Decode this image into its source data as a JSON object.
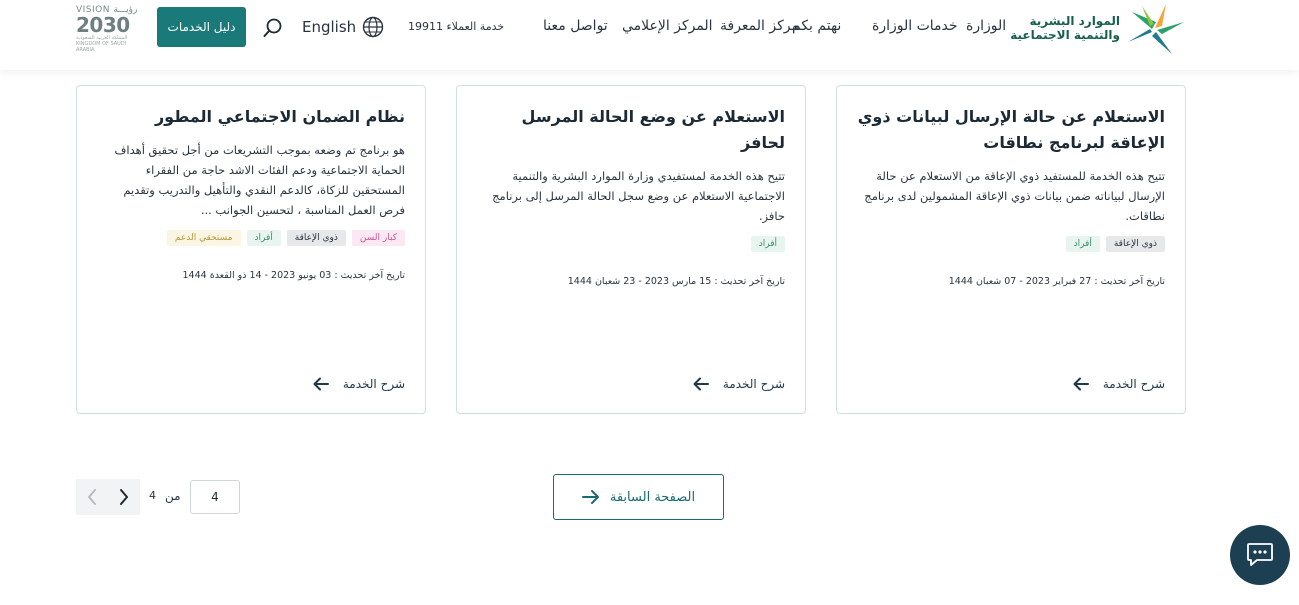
{
  "header": {
    "logo_text_line1": "الموارد البشرية",
    "logo_text_line2": "والتنمية الاجتماعية",
    "nav": [
      {
        "label": "الوزارة"
      },
      {
        "label": "خدمات الوزارة"
      },
      {
        "label": "نهتم بكم"
      },
      {
        "label": "مركز المعرفة"
      },
      {
        "label": "المركز الإعلامي"
      },
      {
        "label": "تواصل معنا"
      }
    ],
    "hotline": "خدمة العملاء 19911",
    "language": "English",
    "guide_button": "دليل الخدمات",
    "vision_top": "VISION رؤيـــة",
    "vision_year": "2030",
    "vision_sub": "المملكة العربية السعودية KINGDOM OF SAUDI ARABIA"
  },
  "cards": [
    {
      "title": "الاستعلام عن حالة الإرسال لبيانات ذوي الإعاقة لبرنامج نطاقات",
      "description": "تتيح هذه الخدمة للمستفيد ذوي الإعاقة من الاستعلام عن حالة الإرسال لبياناته ضمن بيانات ذوي الإعاقة المشمولين لدى برنامج نطاقات.",
      "tags": [
        "ذوي الإعاقة",
        "أفراد"
      ],
      "updated": "تاريخ آخر تحديث : 27 فبراير 2023 - 07 شعبان 1444",
      "explain": "شرح الخدمة"
    },
    {
      "title": "الاستعلام عن وضع الحالة المرسل لحافز",
      "description": "تتيح هذه الخدمة لمستفيدي وزارة الموارد البشرية والتنمية الاجتماعية الاستعلام عن وضع سجل الحالة المرسل إلى برنامج حافز.",
      "tags": [
        "أفراد"
      ],
      "updated": "تاريخ آخر تحديث : 15 مارس 2023 - 23 شعبان 1444",
      "explain": "شرح الخدمة"
    },
    {
      "title": "نظام الضمان الاجتماعي المطور",
      "description": "هو برنامج تم وضعه بموجب التشريعات من أجل تحقيق أهداف الحماية الاجتماعية ودعم الفئات الاشد حاجة من الفقراء المستحقين للزكاة، كالدعم النقدي والتأهيل والتدريب وتقديم فرص العمل المناسبة ، لتحسين الجوانب ...",
      "tags": [
        "كبار السن",
        "ذوي الإعاقة",
        "أفراد",
        "مستحقي الدعم"
      ],
      "updated": "تاريخ آخر تحديث : 03 يونيو 2023 - 14 ذو القعدة 1444",
      "explain": "شرح الخدمة"
    }
  ],
  "pagination": {
    "previous_label": "الصفحة السابقة",
    "current_page": "4",
    "of_label": "من",
    "total_pages": "4"
  }
}
